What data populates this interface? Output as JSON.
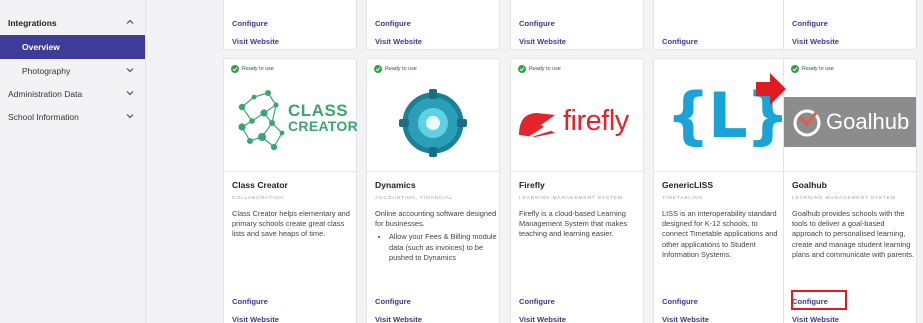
{
  "sidebar": {
    "integrations": "Integrations",
    "overview": "Overview",
    "photography": "Photography",
    "administration_data": "Administration Data",
    "school_information": "School Information"
  },
  "top_cards": [
    {
      "configure": "Configure",
      "visit": "Visit Website"
    },
    {
      "configure": "Configure",
      "visit": "Visit Website"
    },
    {
      "configure": "Configure",
      "visit": "Visit Website"
    },
    {
      "configure": "Configure",
      "visit": ""
    },
    {
      "configure": "Configure",
      "visit": "Visit Website"
    }
  ],
  "cards": [
    {
      "status": "Ready to use",
      "logo_text_1": "CLASS",
      "logo_text_2": "CREATOR",
      "name": "Class Creator",
      "category": "COLLABORATION",
      "description": "Class Creator helps elementary and primary schools create great class lists and save heaps of time.",
      "configure": "Configure",
      "visit": "Visit Website"
    },
    {
      "status": "Ready to use",
      "name": "Dynamics",
      "category": "ACCOUNTING, FINANCIAL",
      "description": "Online accounting software designed for businesses.",
      "bullet": "Allow your Fees & Billing module data (such as invoices) to be pushed to Dynamics",
      "configure": "Configure",
      "visit": "Visit Website"
    },
    {
      "status": "Ready to use",
      "logo_text": "firefly",
      "name": "Firefly",
      "category": "LEARNING MANAGEMENT SYSTEM",
      "description": "Firefly is a cloud-based Learning Management System that makes teaching and learning easier.",
      "configure": "Configure",
      "visit": "Visit Website"
    },
    {
      "logo_text": "{L}",
      "name": "GenericLISS",
      "category": "TIMETABLING",
      "description": "LISS is an interoperability standard designed for K-12 schools, to connect Timetable applications and other applications to Student Information Systems.",
      "configure": "Configure",
      "visit": "Visit Website"
    },
    {
      "status": "Ready to use",
      "logo_text": "Goalhub",
      "name": "Goalhub",
      "category": "LEARNING MANAGEMENT SYSTEM",
      "description": "Goalhub provides schools with the tools to deliver a goal-based approach to personalised learning, create and manage student learning plans and communicate with parents.",
      "configure": "Configure",
      "visit": "Visit Website"
    }
  ],
  "colors": {
    "accent": "#3d3d97",
    "link": "#3b3b8f",
    "ready_green": "#33a04a",
    "highlight": "#e01c22"
  }
}
